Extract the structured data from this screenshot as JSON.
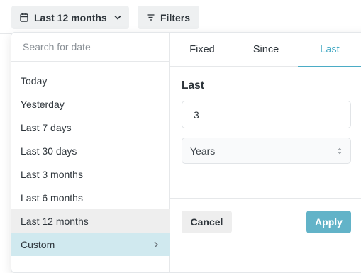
{
  "toolbar": {
    "date_button_label": "Last 12 months",
    "filters_button_label": "Filters"
  },
  "date_picker": {
    "search_placeholder": "Search for date",
    "options": [
      {
        "label": "Today"
      },
      {
        "label": "Yesterday"
      },
      {
        "label": "Last 7 days"
      },
      {
        "label": "Last 30 days"
      },
      {
        "label": "Last 3 months"
      },
      {
        "label": "Last 6 months"
      },
      {
        "label": "Last 12 months",
        "state": "selected"
      },
      {
        "label": "Custom",
        "state": "active"
      }
    ],
    "tabs": [
      {
        "label": "Fixed"
      },
      {
        "label": "Since"
      },
      {
        "label": "Last",
        "active": true
      }
    ],
    "last_section": {
      "title": "Last",
      "amount_value": "3",
      "unit_value": "Years"
    },
    "buttons": {
      "cancel": "Cancel",
      "apply": "Apply"
    }
  },
  "colors": {
    "accent": "#4bacc6",
    "apply_bg": "#62b3c8",
    "active_row_bg": "#d0e9ef",
    "selected_row_bg": "#eeeeee"
  }
}
